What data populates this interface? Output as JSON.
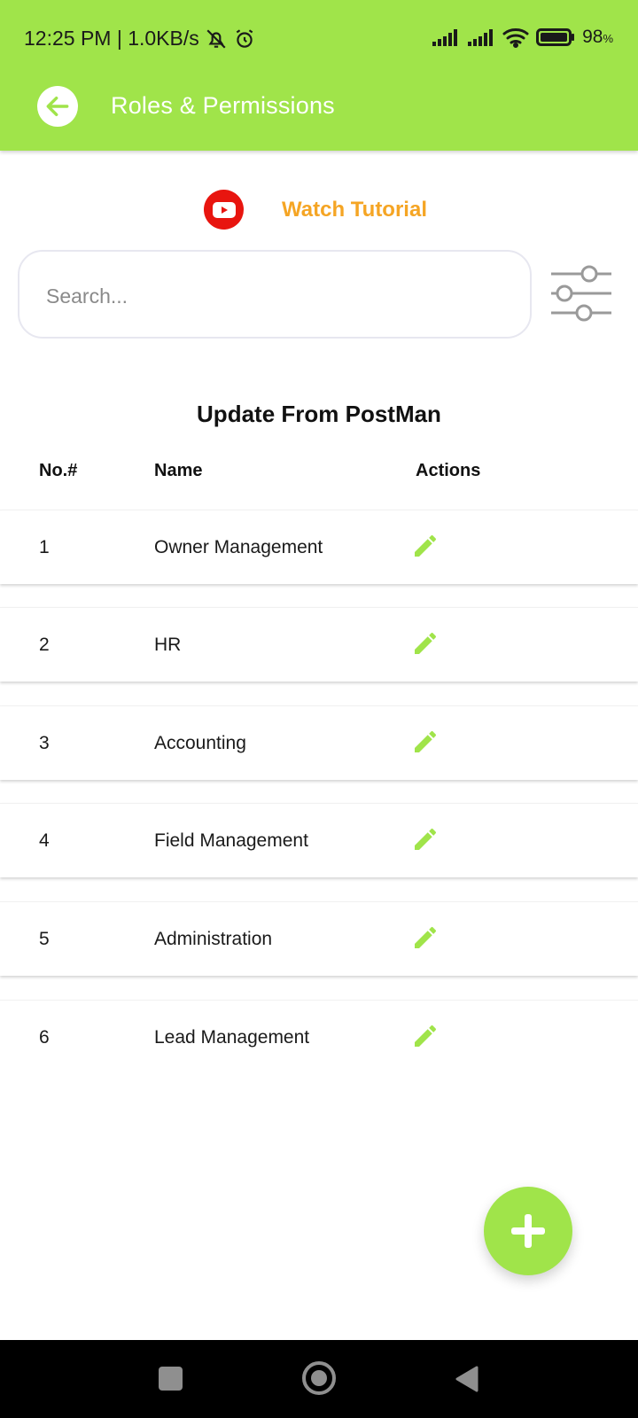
{
  "status_bar": {
    "time_speed": "12:25 PM | 1.0KB/s",
    "battery_level": "98",
    "battery_unit": "%",
    "icons": [
      "bell-off-icon",
      "alarm-icon",
      "signal-icon",
      "signal-icon",
      "wifi-icon",
      "battery-icon"
    ]
  },
  "app_bar": {
    "title": "Roles & Permissions",
    "back_icon": "back-arrow-icon"
  },
  "tutorial": {
    "label": "Watch Tutorial",
    "icon": "youtube-icon"
  },
  "search": {
    "placeholder": "Search...",
    "value": ""
  },
  "filter": {
    "icon": "filter-sliders-icon"
  },
  "table": {
    "title": "Update From PostMan",
    "headers": {
      "no": "No.#",
      "name": "Name",
      "actions": "Actions"
    },
    "rows": [
      {
        "no": "1",
        "name": "Owner Management"
      },
      {
        "no": "2",
        "name": "HR"
      },
      {
        "no": "3",
        "name": "Accounting"
      },
      {
        "no": "4",
        "name": "Field Management"
      },
      {
        "no": "5",
        "name": "Administration"
      },
      {
        "no": "6",
        "name": "Lead Management"
      }
    ]
  },
  "fab": {
    "icon": "plus-icon"
  },
  "colors": {
    "accent": "#a0e44a",
    "tutorial_text": "#f5a524",
    "youtube_red": "#e8150f"
  }
}
